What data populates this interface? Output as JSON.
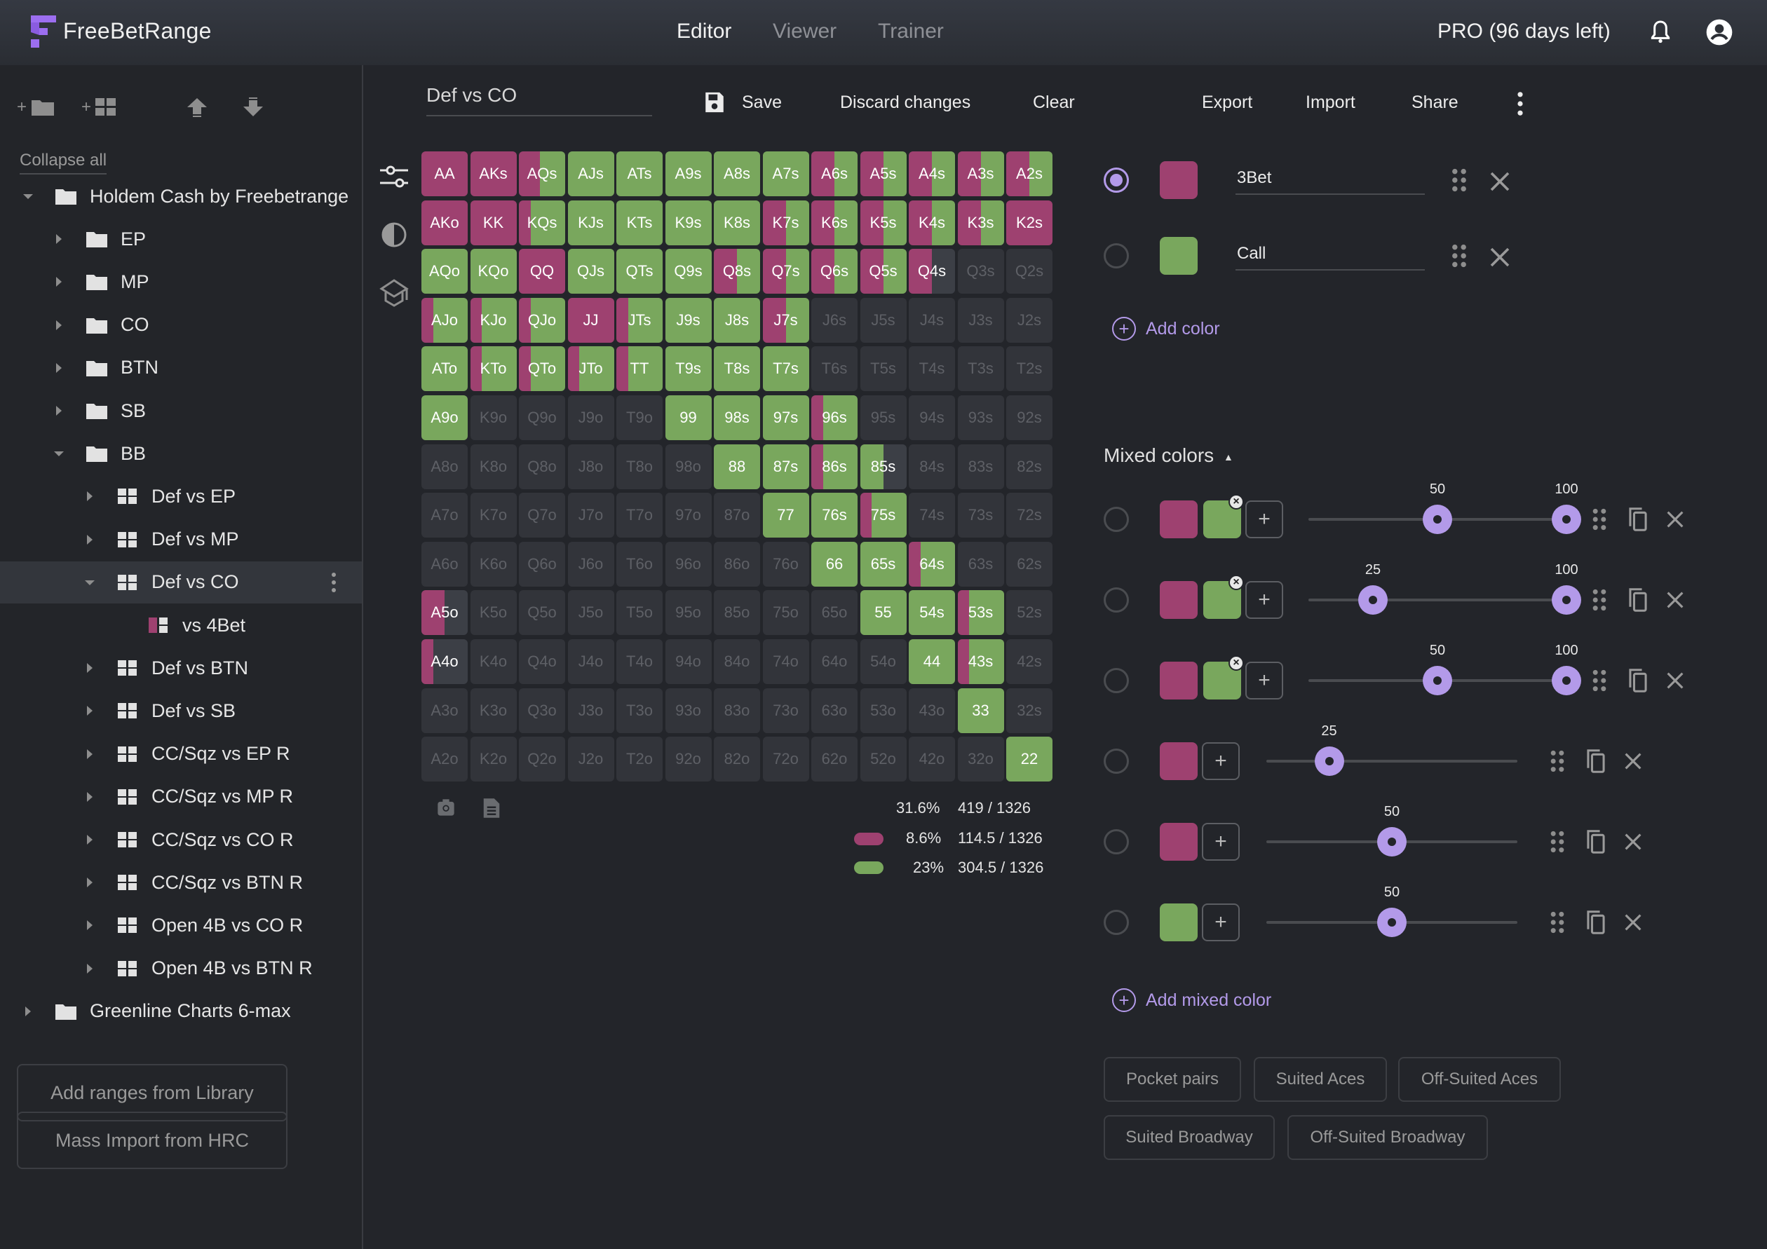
{
  "app": {
    "brand": "FreeBetRange",
    "nav": [
      {
        "label": "Editor",
        "active": true
      },
      {
        "label": "Viewer",
        "active": false
      },
      {
        "label": "Trainer",
        "active": false
      }
    ],
    "subscription": "PRO (96 days left)",
    "icons": {
      "notifications": "bell-icon",
      "account": "account-circle-icon"
    }
  },
  "sidebar": {
    "toolbar": [
      {
        "name": "add-folder-button",
        "icon": "folder-plus-icon"
      },
      {
        "name": "add-range-button",
        "icon": "grid-plus-icon"
      },
      {
        "name": "export-tree-button",
        "icon": "upload-icon"
      },
      {
        "name": "import-tree-button",
        "icon": "download-icon"
      }
    ],
    "collapse_all": "Collapse all",
    "tree": [
      {
        "label": "Holdem Cash by Freebetrange",
        "type": "folder",
        "depth": 0,
        "expanded": true
      },
      {
        "label": "EP",
        "type": "folder",
        "depth": 1,
        "expanded": false
      },
      {
        "label": "MP",
        "type": "folder",
        "depth": 1,
        "expanded": false
      },
      {
        "label": "CO",
        "type": "folder",
        "depth": 1,
        "expanded": false
      },
      {
        "label": "BTN",
        "type": "folder",
        "depth": 1,
        "expanded": false
      },
      {
        "label": "SB",
        "type": "folder",
        "depth": 1,
        "expanded": false
      },
      {
        "label": "BB",
        "type": "folder",
        "depth": 1,
        "expanded": true
      },
      {
        "label": "Def vs EP",
        "type": "range",
        "depth": 2,
        "expanded": false
      },
      {
        "label": "Def vs MP",
        "type": "range",
        "depth": 2,
        "expanded": false
      },
      {
        "label": "Def vs CO",
        "type": "range",
        "depth": 2,
        "expanded": true,
        "selected": true
      },
      {
        "label": "vs 4Bet",
        "type": "subrange",
        "depth": 3
      },
      {
        "label": "Def vs BTN",
        "type": "range",
        "depth": 2,
        "expanded": false
      },
      {
        "label": "Def vs SB",
        "type": "range",
        "depth": 2,
        "expanded": false
      },
      {
        "label": "CC/Sqz vs EP R",
        "type": "range",
        "depth": 2,
        "expanded": false
      },
      {
        "label": "CC/Sqz vs MP R",
        "type": "range",
        "depth": 2,
        "expanded": false
      },
      {
        "label": "CC/Sqz vs CO R",
        "type": "range",
        "depth": 2,
        "expanded": false
      },
      {
        "label": "CC/Sqz vs BTN R",
        "type": "range",
        "depth": 2,
        "expanded": false
      },
      {
        "label": "Open 4B vs CO R",
        "type": "range",
        "depth": 2,
        "expanded": false
      },
      {
        "label": "Open 4B vs BTN R",
        "type": "range",
        "depth": 2,
        "expanded": false
      },
      {
        "label": "Greenline Charts 6-max",
        "type": "folder",
        "depth": 0,
        "expanded": false
      }
    ],
    "buttons": {
      "add_library": "Add ranges from Library",
      "mass_import": "Mass Import from HRC"
    }
  },
  "editor": {
    "range_name": "Def vs CO",
    "toolbar": {
      "save": "Save",
      "discard": "Discard changes",
      "clear": "Clear",
      "export": "Export",
      "import": "Import",
      "share": "Share"
    },
    "side_tools": [
      "sliders-icon",
      "contrast-icon",
      "graduation-cap-icon"
    ],
    "bottom_tools": [
      "camera-icon",
      "document-icon"
    ],
    "colors": {
      "threebet": "#9e4170",
      "call": "#79a75d",
      "empty": "#32343a",
      "partial_empty": "#3c3f46"
    },
    "grid_rows": [
      [
        [
          "AA",
          1,
          0
        ],
        [
          "AKs",
          1,
          0
        ],
        [
          "AQs",
          0.45,
          0.55
        ],
        [
          "AJs",
          0,
          1
        ],
        [
          "ATs",
          0,
          1
        ],
        [
          "A9s",
          0,
          1
        ],
        [
          "A8s",
          0,
          1
        ],
        [
          "A7s",
          0,
          1
        ],
        [
          "A6s",
          0.5,
          0.5
        ],
        [
          "A5s",
          0.5,
          0.5
        ],
        [
          "A4s",
          0.5,
          0.5
        ],
        [
          "A3s",
          0.5,
          0.5
        ],
        [
          "A2s",
          0.5,
          0.5
        ]
      ],
      [
        [
          "AKo",
          1,
          0
        ],
        [
          "KK",
          1,
          0
        ],
        [
          "KQs",
          0.25,
          0.75
        ],
        [
          "KJs",
          0,
          1
        ],
        [
          "KTs",
          0,
          1
        ],
        [
          "K9s",
          0,
          1
        ],
        [
          "K8s",
          0,
          1
        ],
        [
          "K7s",
          0.5,
          0.5
        ],
        [
          "K6s",
          0.5,
          0.5
        ],
        [
          "K5s",
          0.5,
          0.5
        ],
        [
          "K4s",
          0.5,
          0.5
        ],
        [
          "K3s",
          0.5,
          0.5
        ],
        [
          "K2s",
          1,
          0
        ]
      ],
      [
        [
          "AQo",
          0,
          1
        ],
        [
          "KQo",
          0,
          1
        ],
        [
          "QQ",
          1,
          0
        ],
        [
          "QJs",
          0,
          1
        ],
        [
          "QTs",
          0,
          1
        ],
        [
          "Q9s",
          0,
          1
        ],
        [
          "Q8s",
          0.5,
          0.5
        ],
        [
          "Q7s",
          0.5,
          0.5
        ],
        [
          "Q6s",
          0.5,
          0.5
        ],
        [
          "Q5s",
          0.5,
          0.5
        ],
        [
          "Q4s",
          0.5,
          0
        ],
        [
          "Q3s",
          0,
          0
        ],
        [
          "Q2s",
          0,
          0
        ]
      ],
      [
        [
          "AJo",
          0.25,
          0.75
        ],
        [
          "KJo",
          0.25,
          0.75
        ],
        [
          "QJo",
          0.25,
          0.75
        ],
        [
          "JJ",
          1,
          0
        ],
        [
          "JTs",
          0.25,
          0.75
        ],
        [
          "J9s",
          0,
          1
        ],
        [
          "J8s",
          0,
          1
        ],
        [
          "J7s",
          0.5,
          0.5
        ],
        [
          "J6s",
          0,
          0
        ],
        [
          "J5s",
          0,
          0
        ],
        [
          "J4s",
          0,
          0
        ],
        [
          "J3s",
          0,
          0
        ],
        [
          "J2s",
          0,
          0
        ]
      ],
      [
        [
          "ATo",
          0,
          1
        ],
        [
          "KTo",
          0.25,
          0.75
        ],
        [
          "QTo",
          0.25,
          0.75
        ],
        [
          "JTo",
          0.25,
          0.75
        ],
        [
          "TT",
          0.25,
          0.75
        ],
        [
          "T9s",
          0,
          1
        ],
        [
          "T8s",
          0,
          1
        ],
        [
          "T7s",
          0,
          1
        ],
        [
          "T6s",
          0,
          0
        ],
        [
          "T5s",
          0,
          0
        ],
        [
          "T4s",
          0,
          0
        ],
        [
          "T3s",
          0,
          0
        ],
        [
          "T2s",
          0,
          0
        ]
      ],
      [
        [
          "A9o",
          0,
          1
        ],
        [
          "K9o",
          0,
          0
        ],
        [
          "Q9o",
          0,
          0
        ],
        [
          "J9o",
          0,
          0
        ],
        [
          "T9o",
          0,
          0
        ],
        [
          "99",
          0,
          1
        ],
        [
          "98s",
          0,
          1
        ],
        [
          "97s",
          0,
          1
        ],
        [
          "96s",
          0.25,
          0.75
        ],
        [
          "95s",
          0,
          0
        ],
        [
          "94s",
          0,
          0
        ],
        [
          "93s",
          0,
          0
        ],
        [
          "92s",
          0,
          0
        ]
      ],
      [
        [
          "A8o",
          0,
          0
        ],
        [
          "K8o",
          0,
          0
        ],
        [
          "Q8o",
          0,
          0
        ],
        [
          "J8o",
          0,
          0
        ],
        [
          "T8o",
          0,
          0
        ],
        [
          "98o",
          0,
          0
        ],
        [
          "88",
          0,
          1
        ],
        [
          "87s",
          0,
          1
        ],
        [
          "86s",
          0.25,
          0.75
        ],
        [
          "85s",
          0,
          0.5
        ],
        [
          "84s",
          0,
          0
        ],
        [
          "83s",
          0,
          0
        ],
        [
          "82s",
          0,
          0
        ]
      ],
      [
        [
          "A7o",
          0,
          0
        ],
        [
          "K7o",
          0,
          0
        ],
        [
          "Q7o",
          0,
          0
        ],
        [
          "J7o",
          0,
          0
        ],
        [
          "T7o",
          0,
          0
        ],
        [
          "97o",
          0,
          0
        ],
        [
          "87o",
          0,
          0
        ],
        [
          "77",
          0,
          1
        ],
        [
          "76s",
          0,
          1
        ],
        [
          "75s",
          0.25,
          0.75
        ],
        [
          "74s",
          0,
          0
        ],
        [
          "73s",
          0,
          0
        ],
        [
          "72s",
          0,
          0
        ]
      ],
      [
        [
          "A6o",
          0,
          0
        ],
        [
          "K6o",
          0,
          0
        ],
        [
          "Q6o",
          0,
          0
        ],
        [
          "J6o",
          0,
          0
        ],
        [
          "T6o",
          0,
          0
        ],
        [
          "96o",
          0,
          0
        ],
        [
          "86o",
          0,
          0
        ],
        [
          "76o",
          0,
          0
        ],
        [
          "66",
          0,
          1
        ],
        [
          "65s",
          0,
          1
        ],
        [
          "64s",
          0.25,
          0.75
        ],
        [
          "63s",
          0,
          0
        ],
        [
          "62s",
          0,
          0
        ]
      ],
      [
        [
          "A5o",
          0.5,
          0
        ],
        [
          "K5o",
          0,
          0
        ],
        [
          "Q5o",
          0,
          0
        ],
        [
          "J5o",
          0,
          0
        ],
        [
          "T5o",
          0,
          0
        ],
        [
          "95o",
          0,
          0
        ],
        [
          "85o",
          0,
          0
        ],
        [
          "75o",
          0,
          0
        ],
        [
          "65o",
          0,
          0
        ],
        [
          "55",
          0,
          1
        ],
        [
          "54s",
          0,
          1
        ],
        [
          "53s",
          0.25,
          0.75
        ],
        [
          "52s",
          0,
          0
        ]
      ],
      [
        [
          "A4o",
          0.25,
          0
        ],
        [
          "K4o",
          0,
          0
        ],
        [
          "Q4o",
          0,
          0
        ],
        [
          "J4o",
          0,
          0
        ],
        [
          "T4o",
          0,
          0
        ],
        [
          "94o",
          0,
          0
        ],
        [
          "84o",
          0,
          0
        ],
        [
          "74o",
          0,
          0
        ],
        [
          "64o",
          0,
          0
        ],
        [
          "54o",
          0,
          0
        ],
        [
          "44",
          0,
          1
        ],
        [
          "43s",
          0.25,
          0.75
        ],
        [
          "42s",
          0,
          0
        ]
      ],
      [
        [
          "A3o",
          0,
          0
        ],
        [
          "K3o",
          0,
          0
        ],
        [
          "Q3o",
          0,
          0
        ],
        [
          "J3o",
          0,
          0
        ],
        [
          "T3o",
          0,
          0
        ],
        [
          "93o",
          0,
          0
        ],
        [
          "83o",
          0,
          0
        ],
        [
          "73o",
          0,
          0
        ],
        [
          "63o",
          0,
          0
        ],
        [
          "53o",
          0,
          0
        ],
        [
          "43o",
          0,
          0
        ],
        [
          "33",
          0,
          1
        ],
        [
          "32s",
          0,
          0
        ]
      ],
      [
        [
          "A2o",
          0,
          0
        ],
        [
          "K2o",
          0,
          0
        ],
        [
          "Q2o",
          0,
          0
        ],
        [
          "J2o",
          0,
          0
        ],
        [
          "T2o",
          0,
          0
        ],
        [
          "92o",
          0,
          0
        ],
        [
          "82o",
          0,
          0
        ],
        [
          "72o",
          0,
          0
        ],
        [
          "62o",
          0,
          0
        ],
        [
          "52o",
          0,
          0
        ],
        [
          "42o",
          0,
          0
        ],
        [
          "32o",
          0,
          0
        ],
        [
          "22",
          0,
          1
        ]
      ]
    ],
    "stats": {
      "total": {
        "percent": "31.6%",
        "combos": "419 / 1326"
      },
      "by_color": [
        {
          "color": "#9e4170",
          "percent": "8.6%",
          "combos": "114.5 / 1326"
        },
        {
          "color": "#79a75d",
          "percent": "23%",
          "combos": "304.5 / 1326"
        }
      ]
    }
  },
  "panel": {
    "colors": [
      {
        "name": "3Bet",
        "color": "#9e4170",
        "selected": true
      },
      {
        "name": "Call",
        "color": "#79a75d",
        "selected": false
      }
    ],
    "add_color": "Add color",
    "mixed_title": "Mixed colors",
    "mixed_toggle": "▲",
    "mixed": [
      {
        "colors": [
          "#9e4170",
          "#79a75d"
        ],
        "values": [
          50,
          100
        ]
      },
      {
        "colors": [
          "#9e4170",
          "#79a75d"
        ],
        "values": [
          25,
          100
        ]
      },
      {
        "colors": [
          "#9e4170",
          "#79a75d"
        ],
        "values": [
          50,
          100
        ]
      },
      {
        "colors": [
          "#9e4170"
        ],
        "values": [
          25
        ]
      },
      {
        "colors": [
          "#9e4170"
        ],
        "values": [
          50
        ]
      },
      {
        "colors": [
          "#79a75d"
        ],
        "values": [
          50
        ]
      }
    ],
    "add_mixed": "Add mixed color",
    "presets": [
      "Pocket pairs",
      "Suited Aces",
      "Off-Suited Aces",
      "Suited Broadway",
      "Off-Suited Broadway"
    ],
    "accent": "#b39ae9"
  }
}
